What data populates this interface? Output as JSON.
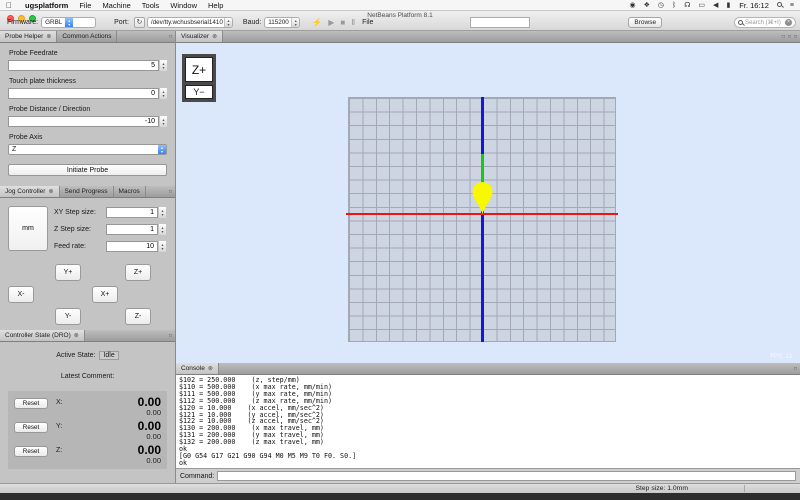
{
  "menubar": {
    "apple": "",
    "items": [
      "ugsplatform",
      "File",
      "Machine",
      "Tools",
      "Window",
      "Help"
    ],
    "status_icons": [
      {
        "name": "controller-icon",
        "glyph": "◉"
      },
      {
        "name": "dropbox-icon",
        "glyph": "❖"
      },
      {
        "name": "time-machine-icon",
        "glyph": "◷"
      },
      {
        "name": "bluetooth-icon",
        "glyph": "ᛒ"
      },
      {
        "name": "wifi-icon",
        "glyph": "☊"
      },
      {
        "name": "display-icon",
        "glyph": "▭"
      },
      {
        "name": "volume-icon",
        "glyph": "◀"
      },
      {
        "name": "battery-icon",
        "glyph": "▮"
      }
    ],
    "clock": "Fr. 16:12",
    "notification_icon": "≡"
  },
  "window": {
    "title": "NetBeans Platform 8.1"
  },
  "toolbar": {
    "firmware_label": "Firmware:",
    "firmware_value": "GRBL",
    "port_label": "Port:",
    "refresh_icon": "↻",
    "port_value": "/dev/tty.wchusbserial1410",
    "baud_label": "Baud:",
    "baud_value": "115200",
    "connect_icon": "⚡",
    "play_icon": "▶",
    "stop_icon": "■",
    "pause_icon": "Ⅱ",
    "file_label": "File",
    "file_value": "",
    "browse_label": "Browse",
    "search_placeholder": "Search (⌘+I)",
    "clear_icon": "×"
  },
  "probe_panel": {
    "tabs": [
      "Probe Helper",
      "Common Actions"
    ],
    "close_icon": "⊗",
    "fields": [
      {
        "label": "Probe Feedrate",
        "value": "5"
      },
      {
        "label": "Touch plate thickness",
        "value": "0"
      },
      {
        "label": "Probe Distance / Direction",
        "value": "-10"
      }
    ],
    "axis_label": "Probe Axis",
    "axis_value": "Z",
    "initiate_label": "Initiate Probe"
  },
  "jog_panel": {
    "tabs": [
      "Jog Controller",
      "Send Progress",
      "Macros"
    ],
    "units_button": "mm",
    "fields": [
      {
        "label": "XY Step size:",
        "value": "1"
      },
      {
        "label": "Z Step size:",
        "value": "1"
      },
      {
        "label": "Feed rate:",
        "value": "10"
      }
    ],
    "buttons": {
      "y_plus": "Y+",
      "y_minus": "Y-",
      "x_plus": "X+",
      "x_minus": "X-",
      "z_plus": "Z+",
      "z_minus": "Z-"
    }
  },
  "dro_panel": {
    "tab": "Controller State (DRO)",
    "active_state_label": "Active State:",
    "active_state_value": "Idle",
    "latest_comment_label": "Latest Comment:",
    "reset_label": "Reset",
    "axes": [
      {
        "label": "X:",
        "work": "0.00",
        "machine": "0.00"
      },
      {
        "label": "Y:",
        "work": "0.00",
        "machine": "0.00"
      },
      {
        "label": "Z:",
        "work": "0.00",
        "machine": "0.00"
      }
    ]
  },
  "visualizer": {
    "tab": "Visualizer",
    "overlay_z_plus": "Z+",
    "overlay_y_minus": "Y−",
    "fps_text": "FPS: 13",
    "window_button": "□",
    "colors": {
      "background": "#dbe7fb",
      "grid_fill": "#cdd4e2",
      "grid_line": "#a2a8b4",
      "x_axis": "#ee1414",
      "z_axis": "#1515dd",
      "path": "#16c916",
      "tool": "#f8f800"
    }
  },
  "console": {
    "tab": "Console",
    "lines": [
      "$102 = 250.000    (z, step/mm)",
      "$110 = 500.000    (x max rate, mm/min)",
      "$111 = 500.000    (y max rate, mm/min)",
      "$112 = 500.000    (z max rate, mm/min)",
      "$120 = 10.000    (x accel, mm/sec^2)",
      "$121 = 10.000    (y accel, mm/sec^2)",
      "$122 = 10.000    (z accel, mm/sec^2)",
      "$130 = 200.000    (x max travel, mm)",
      "$131 = 200.000    (y max travel, mm)",
      "$132 = 200.000    (z max travel, mm)",
      "ok",
      "[G0 G54 G17 G21 G90 G94 M0 M5 M9 T0 F0. S0.]",
      "ok"
    ],
    "command_label": "Command:",
    "command_value": ""
  },
  "statusbar": {
    "step_size": "Step size: 1.0mm"
  }
}
